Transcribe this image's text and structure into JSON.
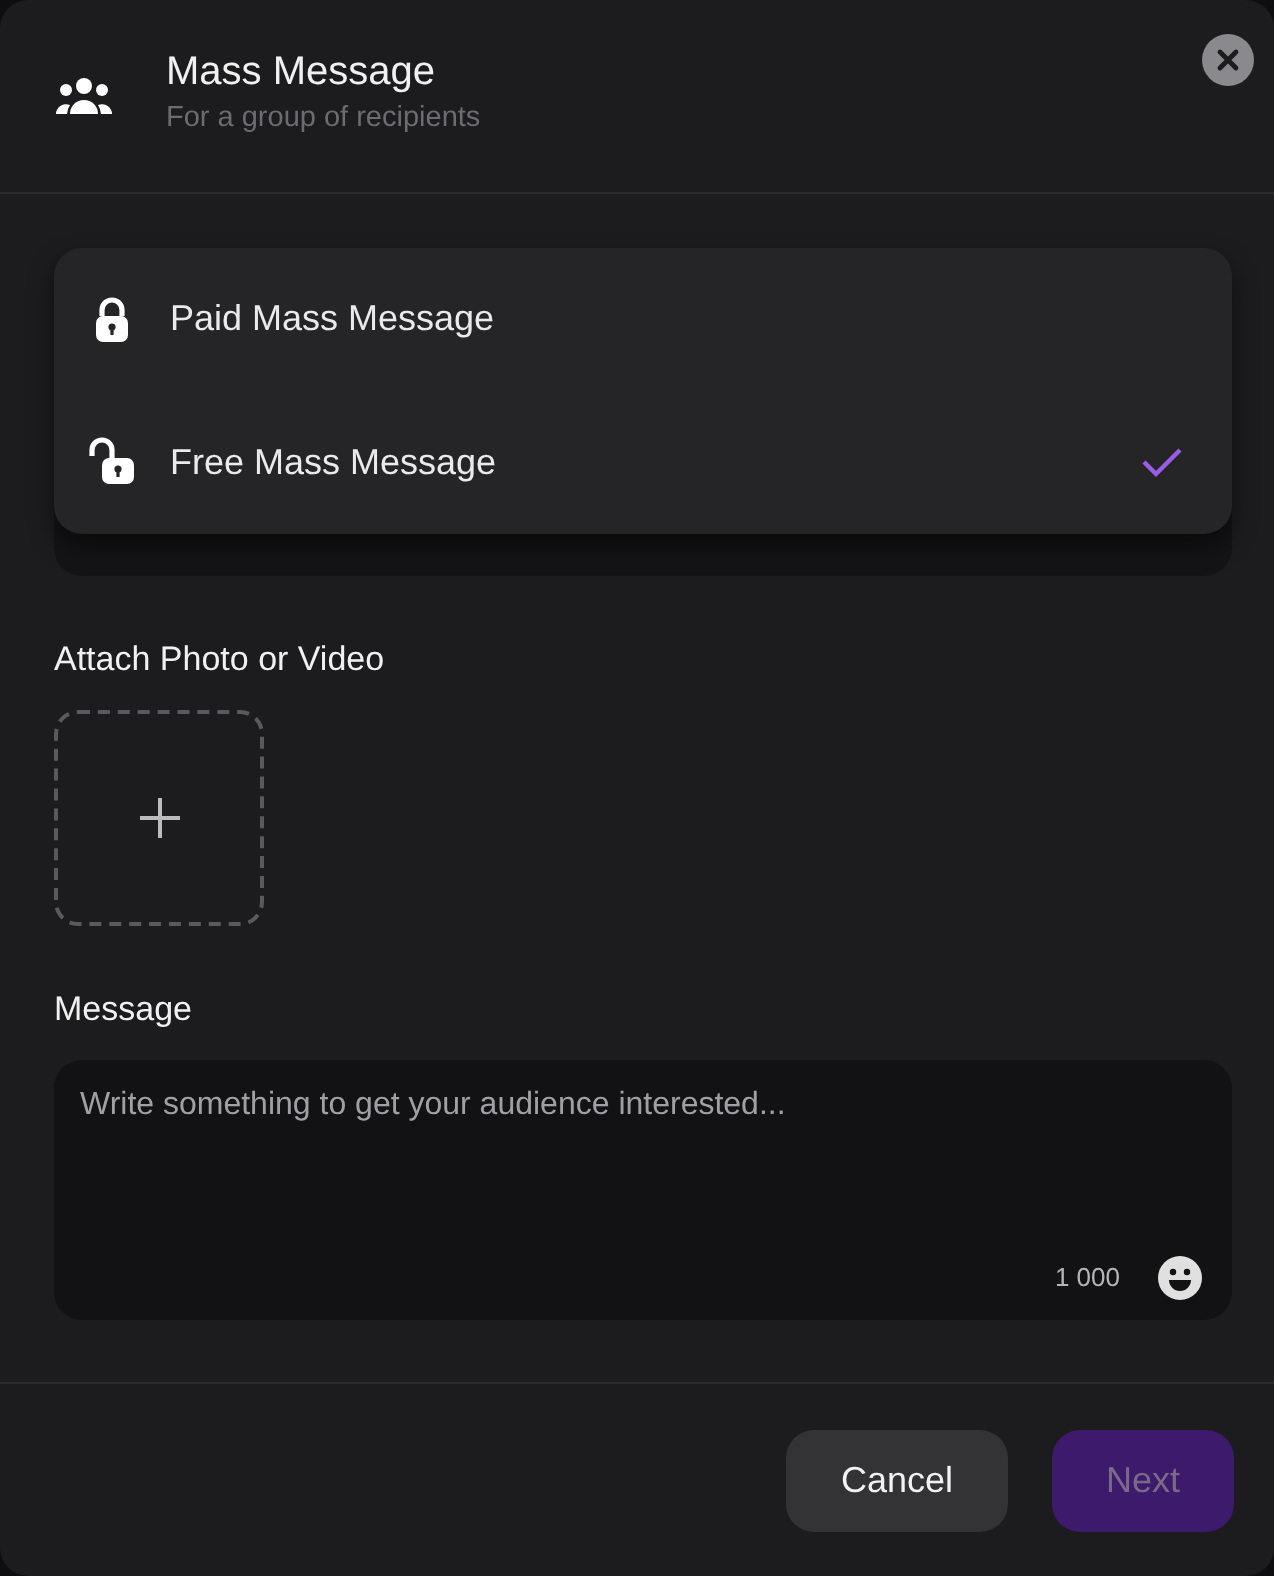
{
  "header": {
    "title": "Mass Message",
    "subtitle": "For a group of recipients"
  },
  "type_menu": {
    "options": [
      {
        "label": "Paid Mass Message",
        "kind": "locked",
        "selected": false
      },
      {
        "label": "Free Mass Message",
        "kind": "unlocked",
        "selected": true
      }
    ]
  },
  "attach": {
    "label": "Attach Photo or Video"
  },
  "message": {
    "label": "Message",
    "placeholder": "Write something to get your audience interested...",
    "counter": "1 000"
  },
  "buttons": [
    {
      "label": "Cancel",
      "kind": "secondary",
      "disabled": false
    },
    {
      "label": "Next",
      "kind": "primary",
      "disabled": true
    }
  ]
}
